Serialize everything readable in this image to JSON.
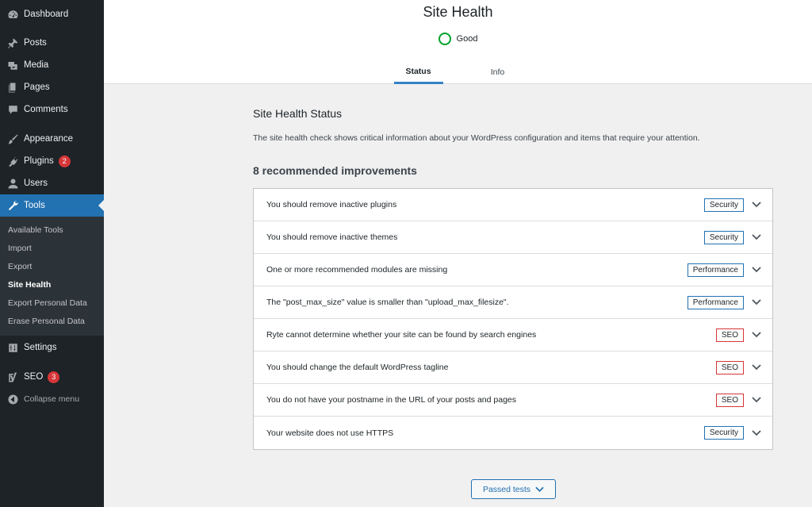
{
  "sidebar": {
    "menu": [
      {
        "label": "Dashboard",
        "icon": "dashboard-icon"
      },
      {
        "label": "Posts",
        "icon": "pin-icon"
      },
      {
        "label": "Media",
        "icon": "media-icon"
      },
      {
        "label": "Pages",
        "icon": "pages-icon"
      },
      {
        "label": "Comments",
        "icon": "comment-icon"
      },
      {
        "label": "Appearance",
        "icon": "brush-icon"
      },
      {
        "label": "Plugins",
        "icon": "plug-icon",
        "badge": "2"
      },
      {
        "label": "Users",
        "icon": "user-icon"
      },
      {
        "label": "Tools",
        "icon": "wrench-icon"
      },
      {
        "label": "Settings",
        "icon": "sliders-icon"
      },
      {
        "label": "SEO",
        "icon": "yoast-icon",
        "badge": "3"
      },
      {
        "label": "Collapse menu",
        "icon": "collapse-arrow-icon"
      }
    ],
    "tools_submenu": [
      "Available Tools",
      "Import",
      "Export",
      "Site Health",
      "Export Personal Data",
      "Erase Personal Data"
    ]
  },
  "header": {
    "title": "Site Health",
    "status": "Good",
    "tabs": [
      "Status",
      "Info"
    ]
  },
  "main": {
    "section_title": "Site Health Status",
    "description": "The site health check shows critical information about your WordPress configuration and items that require your attention.",
    "count_heading": "8 recommended improvements",
    "issues": [
      {
        "label": "You should remove inactive plugins",
        "tag": "Security"
      },
      {
        "label": "You should remove inactive themes",
        "tag": "Security"
      },
      {
        "label": "One or more recommended modules are missing",
        "tag": "Performance"
      },
      {
        "label": "The \"post_max_size\" value is smaller than \"upload_max_filesize\".",
        "tag": "Performance"
      },
      {
        "label": "Ryte cannot determine whether your site can be found by search engines",
        "tag": "SEO"
      },
      {
        "label": "You should change the default WordPress tagline",
        "tag": "SEO"
      },
      {
        "label": "You do not have your postname in the URL of your posts and pages",
        "tag": "SEO"
      },
      {
        "label": "Your website does not use HTTPS",
        "tag": "Security"
      }
    ],
    "passed_button": "Passed tests"
  },
  "colors": {
    "sidebar_bg": "#1d2327",
    "accent": "#2271b1",
    "good": "#00a32a",
    "seo_border": "#d63638"
  }
}
